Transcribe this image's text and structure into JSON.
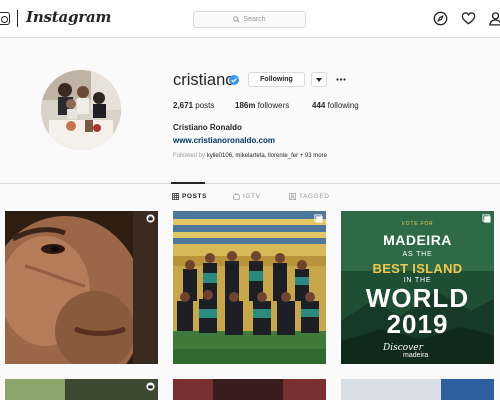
{
  "nav": {
    "wordmark": "Instagram",
    "search_placeholder": "Search",
    "icons": [
      "instagram-glyph-icon",
      "search-icon",
      "compass-icon",
      "heart-icon",
      "user-icon"
    ]
  },
  "profile": {
    "username": "cristiano",
    "verified": true,
    "follow_label": "Following",
    "stats": {
      "posts_count": "2,671",
      "posts_label": "posts",
      "followers_count": "186m",
      "followers_label": "followers",
      "following_count": "444",
      "following_label": "following"
    },
    "full_name": "Cristiano Ronaldo",
    "website": "www.cristianoronaldo.com",
    "followed_by_prefix": "Followed by",
    "followed_by_names": "kylie0106, mikelarteta, llorente_fer",
    "followed_by_more": "+ 93 more"
  },
  "tabs": [
    {
      "label": "POSTS",
      "icon": "grid-icon",
      "active": true
    },
    {
      "label": "IGTV",
      "icon": "igtv-icon",
      "active": false
    },
    {
      "label": "TAGGED",
      "icon": "tag-icon",
      "active": false
    }
  ],
  "posts": {
    "p1_badge": "igtv-icon",
    "p2_badge": "carousel-icon",
    "p3_badge": "carousel-icon",
    "madeira": {
      "vote": "VOTE FOR",
      "line1": "MADEIRA",
      "line2": "AS THE",
      "line3": "BEST ISLAND",
      "line4": "IN THE",
      "line5": "WORLD",
      "line6": "2019",
      "brand": "Discover",
      "brand2": "madeira"
    },
    "row2_badges": [
      "igtv-icon",
      "video-icon",
      "carousel-icon"
    ]
  },
  "colors": {
    "link": "#003569",
    "verified": "#3897f0",
    "border": "#dbdbdb",
    "muted": "#999999"
  }
}
